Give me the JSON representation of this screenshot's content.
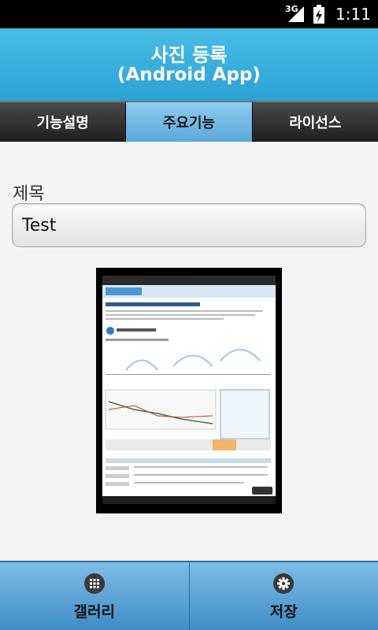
{
  "status": {
    "network": "3G",
    "time": "1:11"
  },
  "header": {
    "title": "사진 등록",
    "subtitle": "(Android App)"
  },
  "tabs": [
    {
      "label": "기능설명",
      "active": false
    },
    {
      "label": "주요기능",
      "active": true
    },
    {
      "label": "라이선스",
      "active": false
    }
  ],
  "form": {
    "title_label": "제목",
    "title_value": "Test"
  },
  "photo": {
    "icon": "photo-thumbnail"
  },
  "bottom": {
    "gallery_label": "갤러리",
    "gallery_icon": "grid-icon",
    "save_label": "저장",
    "save_icon": "gear-icon"
  }
}
